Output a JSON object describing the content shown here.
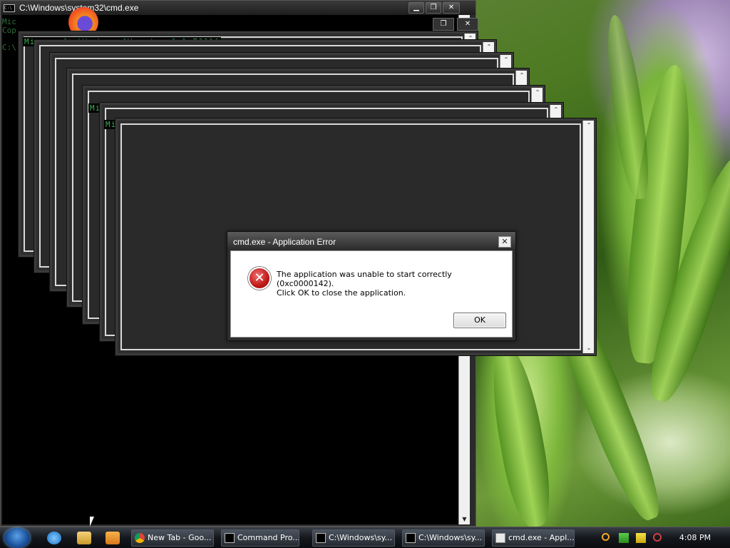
{
  "main_window": {
    "title": "C:\\Windows\\system32\\cmd.exe",
    "icon_text": "C:\\",
    "buttons": [
      "minimize-icon",
      "maximize-icon",
      "close-icon"
    ],
    "faint_lines": [
      "Mic",
      "Cop",
      "C:\\"
    ]
  },
  "stack_windows": {
    "banner": "Microsoft Windows [Version 6.1.7601]"
  },
  "dialog": {
    "title": "cmd.exe - Application Error",
    "message_line1": "The application was unable to start correctly (0xc0000142).",
    "message_line2": "Click OK to close the application.",
    "ok_label": "OK",
    "close_glyph": "✕",
    "icon": "error-icon",
    "error_glyph": "✕"
  },
  "taskbar": {
    "tasks": [
      {
        "label": "New Tab - Goo...",
        "icon": "chrome-icon"
      },
      {
        "label": "Command Pro...",
        "icon": "cmd-icon"
      },
      {
        "label": "C:\\Windows\\sy...",
        "icon": "cmd-icon"
      },
      {
        "label": "C:\\Windows\\sy...",
        "icon": "cmd-icon"
      },
      {
        "label": "cmd.exe - Appl...",
        "icon": "app-window-icon"
      }
    ],
    "clock": "4:08 PM"
  },
  "colors": {
    "console_text": "#3fae54",
    "error_red": "#c01818"
  }
}
